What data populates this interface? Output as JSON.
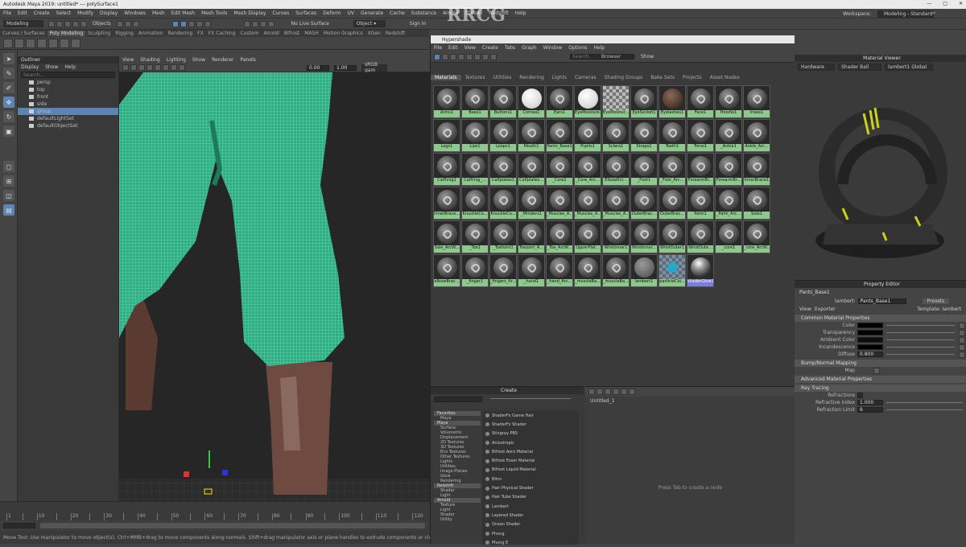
{
  "titlebar": {
    "title": "Autodesk Maya 2019: untitled*   ---   polySurface1",
    "min": "—",
    "max": "□",
    "close": "✕"
  },
  "menubar": {
    "items": [
      "File",
      "Edit",
      "Create",
      "Select",
      "Modify",
      "Display",
      "Windows",
      "Mesh",
      "Edit Mesh",
      "Mesh Tools",
      "Mesh Display",
      "Curves",
      "Surfaces",
      "Deform",
      "UV",
      "Generate",
      "Cache",
      "Substance",
      "Arnold",
      "3DtoAll",
      "Redshift",
      "Help"
    ],
    "workspace_label": "Workspace:",
    "workspace_value": "Modeling - Standard*"
  },
  "statusline": {
    "mode": "Modeling",
    "objects": "Objects",
    "live_surface": "No Live Surface",
    "object_field": "Object ▾",
    "signin": "Sign In"
  },
  "shelf": {
    "tabs": [
      "Curves / Surfaces",
      "Poly Modeling",
      "Sculpting",
      "Rigging",
      "Animation",
      "Rendering",
      "FX",
      "FX Caching",
      "Custom",
      "Arnold",
      "Bifrost",
      "MASH",
      "Motion Graphics",
      "XGen",
      "Redshift"
    ],
    "active_index": 1
  },
  "outliner": {
    "title": "Outliner",
    "menu": [
      "Display",
      "Show",
      "Help"
    ],
    "search_placeholder": "Search...",
    "items": [
      "persp",
      "top",
      "front",
      "side",
      "group",
      "defaultLightSet",
      "defaultObjectSet"
    ],
    "selected_index": 4
  },
  "viewport": {
    "menu": [
      "View",
      "Shading",
      "Lighting",
      "Show",
      "Renderer",
      "Panels"
    ],
    "field1": "0.00",
    "field2": "1.00",
    "colorspace": "sRGB gam"
  },
  "timeline": {
    "ticks": [
      "1",
      "",
      "10",
      "",
      "20",
      "",
      "30",
      "",
      "40",
      "",
      "50",
      "",
      "60",
      "",
      "70",
      "",
      "80",
      "",
      "90",
      "",
      "100",
      "",
      "110",
      "",
      "120"
    ]
  },
  "helpline": {
    "text": "Move Tool: Use manipulator to move object(s). Ctrl+MMB+drag to move components along normals. Shift+drag manipulator axis or plane handles to extrude components or clone objects. Ctrl+Shift+LMB+drag to constrain movement to a connected edge."
  },
  "hypershade": {
    "title": "Hypershade",
    "menu": [
      "File",
      "Edit",
      "View",
      "Create",
      "Tabs",
      "Graph",
      "Window",
      "Options",
      "Help"
    ],
    "browser_label": "Browser",
    "search_placeholder": "Search...",
    "show_label": "Show",
    "tabs": [
      "Materials",
      "Textures",
      "Utilities",
      "Rendering",
      "Lights",
      "Cameras",
      "Shading Groups",
      "Bake Sets",
      "Projects",
      "Asset Nodes"
    ],
    "active_tab": 0,
    "materials": [
      {
        "name": "Arms1",
        "kind": "std"
      },
      {
        "name": "Base1",
        "kind": "std"
      },
      {
        "name": "Buttons1",
        "kind": "std"
      },
      {
        "name": "Cornea1",
        "kind": "white"
      },
      {
        "name": "Ears1",
        "kind": "std"
      },
      {
        "name": "EyeMoisture1",
        "kind": "white"
      },
      {
        "name": "EyeMoistur...",
        "kind": "checker"
      },
      {
        "name": "EyeSocket1",
        "kind": "std"
      },
      {
        "name": "Eyelashes1",
        "kind": "brown"
      },
      {
        "name": "Face1",
        "kind": "std"
      },
      {
        "name": "Hoodie1",
        "kind": "std"
      },
      {
        "name": "Irises1",
        "kind": "std"
      },
      {
        "name": "Legs1",
        "kind": "std"
      },
      {
        "name": "Lips1",
        "kind": "std"
      },
      {
        "name": "Loops1",
        "kind": "std"
      },
      {
        "name": "Mouth1",
        "kind": "std"
      },
      {
        "name": "Pants_Base1",
        "kind": "std"
      },
      {
        "name": "Pupils1",
        "kind": "std"
      },
      {
        "name": "Sclera1",
        "kind": "std"
      },
      {
        "name": "Straps1",
        "kind": "std"
      },
      {
        "name": "Teeth1",
        "kind": "std"
      },
      {
        "name": "Torso1",
        "kind": "std"
      },
      {
        "name": "_Ankle1",
        "kind": "std"
      },
      {
        "name": "Ankle_Arc...",
        "kind": "std"
      },
      {
        "name": "Calflinig1",
        "kind": "std"
      },
      {
        "name": "Calflinig_...",
        "kind": "std"
      },
      {
        "name": "Calfplates1",
        "kind": "std"
      },
      {
        "name": "Calfplates...",
        "kind": "std"
      },
      {
        "name": "_Core1",
        "kind": "std"
      },
      {
        "name": "_Core_Arc...",
        "kind": "std"
      },
      {
        "name": "ElbowKni...",
        "kind": "std"
      },
      {
        "name": "_Foot1",
        "kind": "std"
      },
      {
        "name": "_Foot_Arc...",
        "kind": "std"
      },
      {
        "name": "ForearmBr...",
        "kind": "std"
      },
      {
        "name": "ForearmBr...",
        "kind": "std"
      },
      {
        "name": "InnerBrace1",
        "kind": "std"
      },
      {
        "name": "InnerBrace...",
        "kind": "std"
      },
      {
        "name": "KnuckleCo...",
        "kind": "std"
      },
      {
        "name": "KnuckleCo...",
        "kind": "std"
      },
      {
        "name": "_Minders1",
        "kind": "std"
      },
      {
        "name": "_Muscles_A...",
        "kind": "std"
      },
      {
        "name": "_Muscles_A...",
        "kind": "std"
      },
      {
        "name": "_Muscles_A...",
        "kind": "std"
      },
      {
        "name": "OuterBrac...",
        "kind": "std"
      },
      {
        "name": "OuterBrac...",
        "kind": "std"
      },
      {
        "name": "Palm1",
        "kind": "std"
      },
      {
        "name": "_Palm_Arc...",
        "kind": "std"
      },
      {
        "name": "Sole1",
        "kind": "std"
      },
      {
        "name": "Sole_ArcW...",
        "kind": "std"
      },
      {
        "name": "_Toe1",
        "kind": "std"
      },
      {
        "name": "_Toefoint1",
        "kind": "std"
      },
      {
        "name": "Toejoint_A...",
        "kind": "std"
      },
      {
        "name": "_Toe_ArcW...",
        "kind": "std"
      },
      {
        "name": "UpperPlat...",
        "kind": "std"
      },
      {
        "name": "Wristinner1",
        "kind": "std"
      },
      {
        "name": "Wristinner...",
        "kind": "std"
      },
      {
        "name": "WristOuter1",
        "kind": "std"
      },
      {
        "name": "WristOute...",
        "kind": "std"
      },
      {
        "name": "_core1",
        "kind": "std"
      },
      {
        "name": "_core_ArcW...",
        "kind": "std"
      },
      {
        "name": "elbowBrac...",
        "kind": "std"
      },
      {
        "name": "_finger1",
        "kind": "std"
      },
      {
        "name": "_fingers_Ar...",
        "kind": "std"
      },
      {
        "name": "_hand1",
        "kind": "std"
      },
      {
        "name": "_hand_Arc...",
        "kind": "std"
      },
      {
        "name": "_muscleBa...",
        "kind": "std"
      },
      {
        "name": "_muscleBa...",
        "kind": "std"
      },
      {
        "name": "lambert1",
        "kind": "grey"
      },
      {
        "name": "particleClo...",
        "kind": "blue"
      },
      {
        "name": "shaderGlow1",
        "kind": "shiny",
        "selected": true
      }
    ],
    "create": {
      "title": "Create",
      "tree": [
        {
          "label": "Favorites",
          "h": true
        },
        {
          "label": "Maya",
          "h": false
        },
        {
          "label": "Maya",
          "h": true
        },
        {
          "label": "Surface",
          "h": false
        },
        {
          "label": "Volumetric",
          "h": false
        },
        {
          "label": "Displacement",
          "h": false
        },
        {
          "label": "2D Textures",
          "h": false
        },
        {
          "label": "3D Textures",
          "h": false
        },
        {
          "label": "Env Textures",
          "h": false
        },
        {
          "label": "Other Textures",
          "h": false
        },
        {
          "label": "Lights",
          "h": false
        },
        {
          "label": "Utilities",
          "h": false
        },
        {
          "label": "Image Planes",
          "h": false
        },
        {
          "label": "Glow",
          "h": false
        },
        {
          "label": "Rendering",
          "h": false
        },
        {
          "label": "Redshift",
          "h": true
        },
        {
          "label": "Shader",
          "h": false
        },
        {
          "label": "Light",
          "h": false
        },
        {
          "label": "Arnold",
          "h": true
        },
        {
          "label": "Texture",
          "h": false
        },
        {
          "label": "Light",
          "h": false
        },
        {
          "label": "Shader",
          "h": false
        },
        {
          "label": "Utility",
          "h": false
        }
      ],
      "list": [
        "ShaderFx Game Hair",
        "ShaderFx Shader",
        "Stingray PBS",
        "Anisotropic",
        "Bifrost Aero Material",
        "Bifrost Foam Material",
        "Bifrost Liquid Material",
        "Blinn",
        "Hair Physical Shader",
        "Hair Tube Shader",
        "Lambert",
        "Layered Shader",
        "Ocean Shader",
        "Phong",
        "Phong E"
      ]
    },
    "graph": {
      "tab": "Untitled_1",
      "hint": "Press Tab to create a node"
    }
  },
  "material_viewer": {
    "title": "Material Viewer",
    "renderer": "Hardware",
    "shape": "Shader Ball",
    "material": "lambert1 Global"
  },
  "attr_editor": {
    "title": "Property Editor",
    "node": "Pants_Base1",
    "type_label": "lambert:",
    "type_value": "Pants_Base1",
    "presets": "Presets",
    "view_label": "View:",
    "view_value": "Exporter",
    "template": "Template: lambert",
    "sections": [
      "Common Material Properties",
      "Bump/Normal Mapping",
      "Advanced Material Properties",
      "Ray Tracing"
    ],
    "common": [
      {
        "label": "Color",
        "value": ""
      },
      {
        "label": "Transparency",
        "value": ""
      },
      {
        "label": "Ambient Color",
        "value": ""
      },
      {
        "label": "Incandescence",
        "value": ""
      },
      {
        "label": "Diffuse",
        "value": "0.800"
      }
    ],
    "bump_label": "Map",
    "raytracing": [
      {
        "label": "Refractions",
        "value": ""
      },
      {
        "label": "Refractive Index",
        "value": "1.000"
      },
      {
        "label": "Refraction Limit",
        "value": "6"
      }
    ]
  },
  "watermark": {
    "text": "RRCG"
  }
}
